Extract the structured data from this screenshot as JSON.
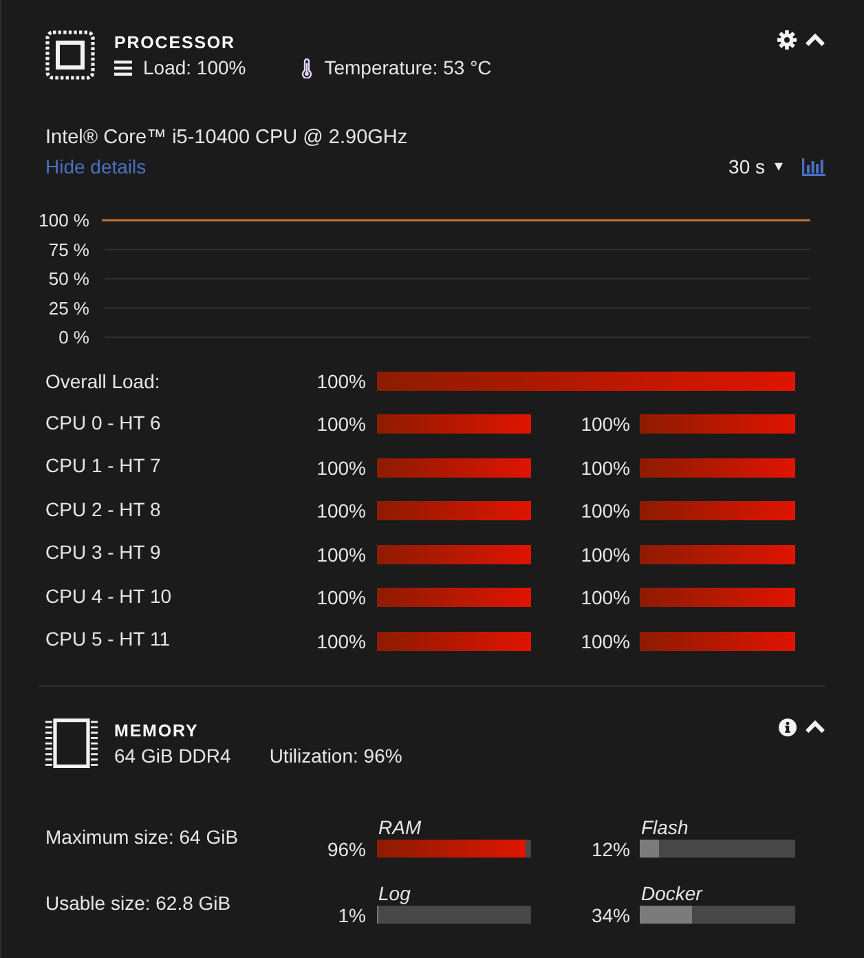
{
  "processor": {
    "title": "PROCESSOR",
    "load": "Load: 100%",
    "temperature": "Temperature: 53 °C",
    "model": "Intel® Core™ i5-10400 CPU @ 2.90GHz",
    "details_link": "Hide details",
    "interval": "30 s",
    "chart_data": {
      "type": "line",
      "grid": true,
      "ylim": [
        0,
        100
      ],
      "yticks": [
        {
          "value": 100,
          "label": "100 %"
        },
        {
          "value": 75,
          "label": "75 %"
        },
        {
          "value": 50,
          "label": "50 %"
        },
        {
          "value": 25,
          "label": "25 %"
        },
        {
          "value": 0,
          "label": "0 %"
        }
      ],
      "series": [
        {
          "color": "#c8732c",
          "values": [
            100,
            100,
            100,
            100,
            100,
            100,
            100,
            100,
            100,
            100,
            100,
            100,
            100,
            100,
            100,
            100,
            100,
            100,
            100,
            100,
            100,
            100,
            100,
            100,
            100,
            100,
            100,
            100,
            100,
            100
          ]
        }
      ]
    },
    "overall": {
      "label": "Overall Load:",
      "reading": "100%",
      "level": 1
    },
    "cores": [
      {
        "label": "CPU 0 - HT 6",
        "threads": [
          {
            "reading": "100%",
            "level": 1
          },
          {
            "reading": "100%",
            "level": 1
          }
        ]
      },
      {
        "label": "CPU 1 - HT 7",
        "threads": [
          {
            "reading": "100%",
            "level": 1
          },
          {
            "reading": "100%",
            "level": 1
          }
        ]
      },
      {
        "label": "CPU 2 - HT 8",
        "threads": [
          {
            "reading": "100%",
            "level": 1
          },
          {
            "reading": "100%",
            "level": 1
          }
        ]
      },
      {
        "label": "CPU 3 - HT 9",
        "threads": [
          {
            "reading": "100%",
            "level": 1
          },
          {
            "reading": "100%",
            "level": 1
          }
        ]
      },
      {
        "label": "CPU 4 - HT 10",
        "threads": [
          {
            "reading": "100%",
            "level": 1
          },
          {
            "reading": "100%",
            "level": 1
          }
        ]
      },
      {
        "label": "CPU 5 - HT 11",
        "threads": [
          {
            "reading": "100%",
            "level": 1
          },
          {
            "reading": "100%",
            "level": 1
          }
        ]
      }
    ]
  },
  "memory": {
    "title": "MEMORY",
    "capacity": "64 GiB DDR4",
    "utilization": "Utilization: 96%",
    "rows": [
      {
        "label": "Maximum size: 64 GiB",
        "gauges": [
          {
            "name": "RAM",
            "reading": "96%",
            "level": 0.96
          },
          {
            "name": "Flash",
            "reading": "12%",
            "level": 0.12
          }
        ]
      },
      {
        "label": "Usable size: 62.8 GiB",
        "gauges": [
          {
            "name": "Log",
            "reading": "1%",
            "level": 0.01
          },
          {
            "name": "Docker",
            "reading": "34%",
            "level": 0.34
          }
        ]
      }
    ]
  }
}
